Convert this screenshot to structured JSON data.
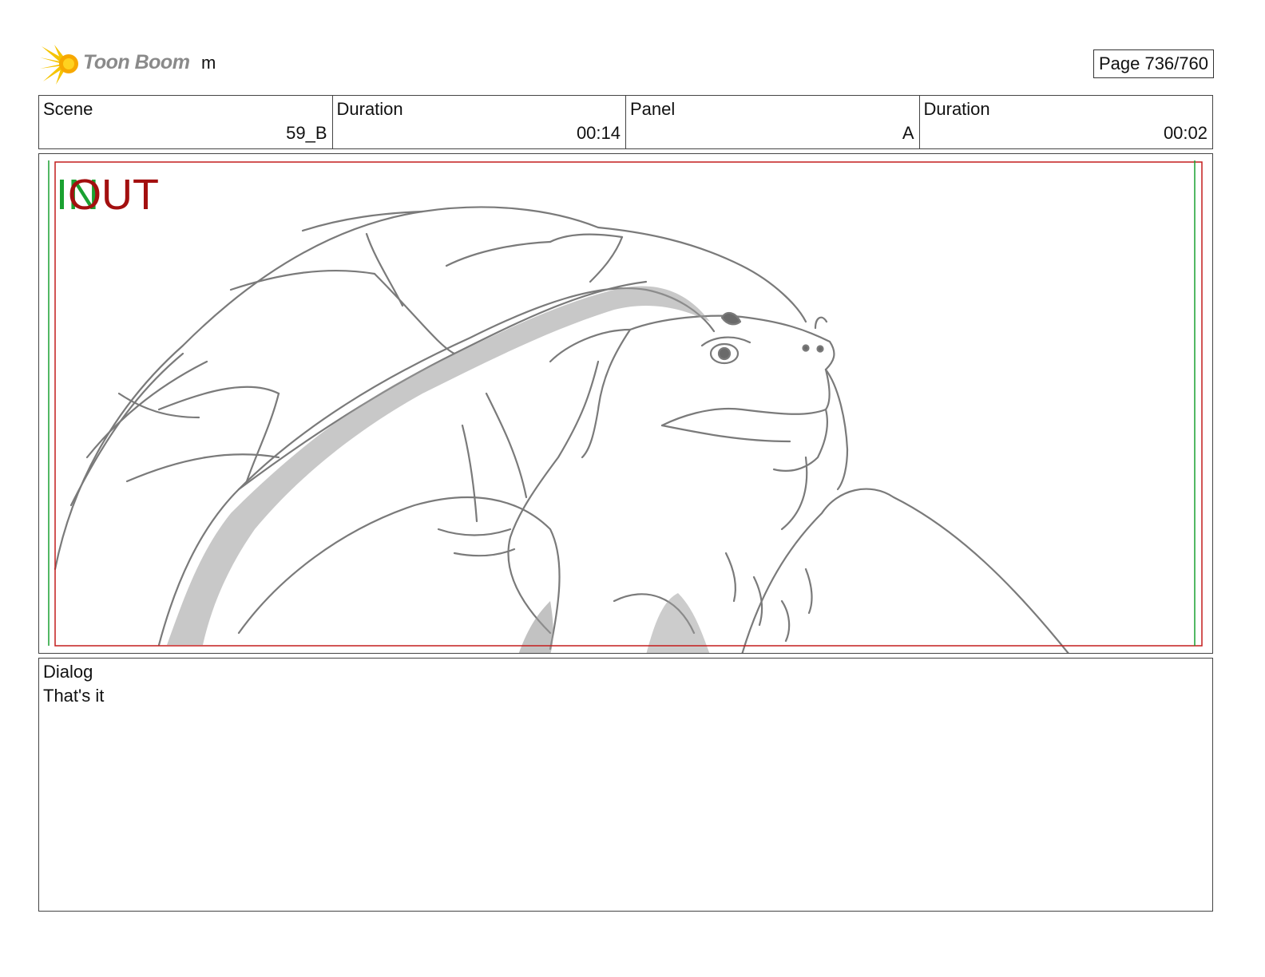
{
  "header": {
    "logo_text": "Toon Boom",
    "project_name": "m",
    "page_indicator": "Page 736/760"
  },
  "info": {
    "scene_label": "Scene",
    "scene_value": "59_B",
    "scene_duration_label": "Duration",
    "scene_duration_value": "00:14",
    "panel_label": "Panel",
    "panel_value": "A",
    "panel_duration_label": "Duration",
    "panel_duration_value": "00:02"
  },
  "panel": {
    "in_marker": "IN",
    "out_marker": "OUT",
    "in_color": "#1aa131",
    "out_color": "#a30f0f"
  },
  "dialog": {
    "label": "Dialog",
    "text": "That's it"
  }
}
